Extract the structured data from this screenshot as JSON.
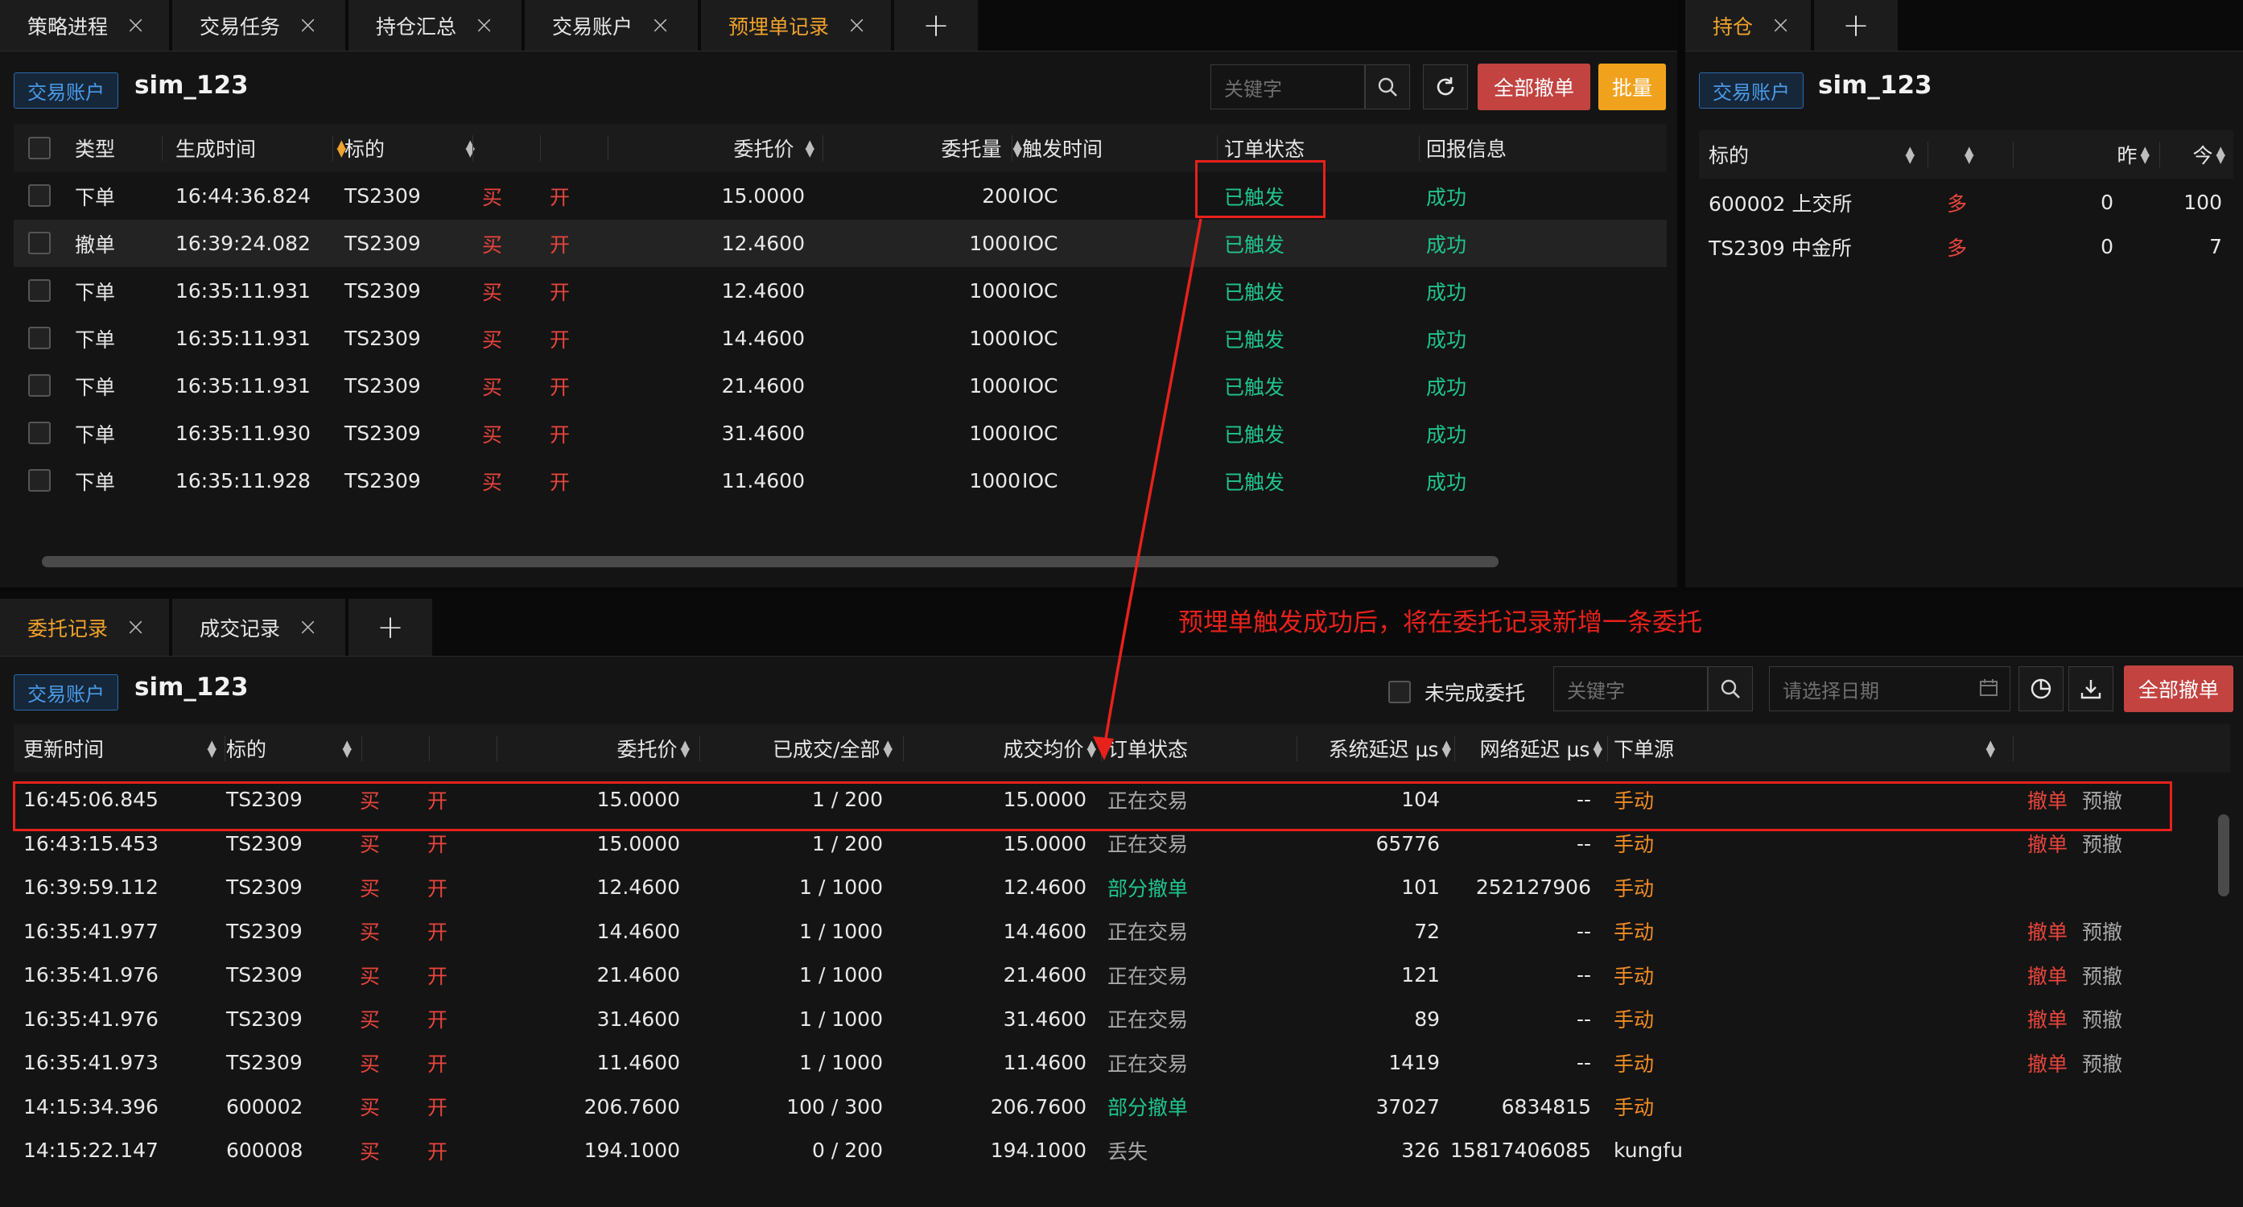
{
  "top_tabs": [
    {
      "label": "策略进程",
      "active": false
    },
    {
      "label": "交易任务",
      "active": false
    },
    {
      "label": "持仓汇总",
      "active": false
    },
    {
      "label": "交易账户",
      "active": false
    },
    {
      "label": "预埋单记录",
      "active": true
    }
  ],
  "right_tabs": [
    {
      "label": "持仓",
      "active": true
    }
  ],
  "bottom_tabs": [
    {
      "label": "委托记录",
      "active": true
    },
    {
      "label": "成交记录",
      "active": false
    }
  ],
  "common": {
    "close_glyph": "×",
    "plus_glyph": "+",
    "account_badge": "交易账户",
    "account_name": "sim_123"
  },
  "preorder": {
    "search_placeholder": "关键字",
    "cancel_all_label": "全部撤单",
    "batch_label": "批量",
    "columns": {
      "type": "类型",
      "time": "生成时间",
      "symbol": "标的",
      "price": "委托价",
      "volume": "委托量",
      "trigger": "触发时间",
      "status": "订单状态",
      "reply": "回报信息"
    },
    "rows": [
      {
        "type": "下单",
        "time": "16:44:36.824",
        "symbol": "TS2309",
        "side": "买",
        "offset": "开",
        "price": "15.0000",
        "volume": "200",
        "trigger": "IOC",
        "status": "已触发",
        "reply": "成功"
      },
      {
        "type": "撤单",
        "time": "16:39:24.082",
        "symbol": "TS2309",
        "side": "买",
        "offset": "开",
        "price": "12.4600",
        "volume": "1000",
        "trigger": "IOC",
        "status": "已触发",
        "reply": "成功"
      },
      {
        "type": "下单",
        "time": "16:35:11.931",
        "symbol": "TS2309",
        "side": "买",
        "offset": "开",
        "price": "12.4600",
        "volume": "1000",
        "trigger": "IOC",
        "status": "已触发",
        "reply": "成功"
      },
      {
        "type": "下单",
        "time": "16:35:11.931",
        "symbol": "TS2309",
        "side": "买",
        "offset": "开",
        "price": "14.4600",
        "volume": "1000",
        "trigger": "IOC",
        "status": "已触发",
        "reply": "成功"
      },
      {
        "type": "下单",
        "time": "16:35:11.931",
        "symbol": "TS2309",
        "side": "买",
        "offset": "开",
        "price": "21.4600",
        "volume": "1000",
        "trigger": "IOC",
        "status": "已触发",
        "reply": "成功"
      },
      {
        "type": "下单",
        "time": "16:35:11.930",
        "symbol": "TS2309",
        "side": "买",
        "offset": "开",
        "price": "31.4600",
        "volume": "1000",
        "trigger": "IOC",
        "status": "已触发",
        "reply": "成功"
      },
      {
        "type": "下单",
        "time": "16:35:11.928",
        "symbol": "TS2309",
        "side": "买",
        "offset": "开",
        "price": "11.4600",
        "volume": "1000",
        "trigger": "IOC",
        "status": "已触发",
        "reply": "成功"
      }
    ]
  },
  "position": {
    "columns": {
      "symbol": "标的",
      "yesterday": "昨",
      "today": "今"
    },
    "rows": [
      {
        "symbol": "600002 上交所",
        "dir": "多",
        "yesterday": "0",
        "today": "100"
      },
      {
        "symbol": "TS2309 中金所",
        "dir": "多",
        "yesterday": "0",
        "today": "7"
      }
    ]
  },
  "orders": {
    "unfinished_label": "未完成委托",
    "search_placeholder": "关键字",
    "date_placeholder": "请选择日期",
    "cancel_all_label": "全部撤单",
    "columns": {
      "time": "更新时间",
      "symbol": "标的",
      "price": "委托价",
      "filled": "已成交/全部",
      "avg": "成交均价",
      "status": "订单状态",
      "sys_latency": "系统延迟 μs",
      "net_latency": "网络延迟 μs",
      "source": "下单源"
    },
    "rows": [
      {
        "time": "16:45:06.845",
        "symbol": "TS2309",
        "side": "买",
        "offset": "开",
        "price": "15.0000",
        "filled": "1 / 200",
        "avg": "15.0000",
        "status": "正在交易",
        "status_kind": "gray",
        "sys": "104",
        "net": "--",
        "source": "手动",
        "source_kind": "orange",
        "cancel": "撤单",
        "precancel": "预撤"
      },
      {
        "time": "16:43:15.453",
        "symbol": "TS2309",
        "side": "买",
        "offset": "开",
        "price": "15.0000",
        "filled": "1 / 200",
        "avg": "15.0000",
        "status": "正在交易",
        "status_kind": "gray",
        "sys": "65776",
        "net": "--",
        "source": "手动",
        "source_kind": "orange",
        "cancel": "撤单",
        "precancel": "预撤"
      },
      {
        "time": "16:39:59.112",
        "symbol": "TS2309",
        "side": "买",
        "offset": "开",
        "price": "12.4600",
        "filled": "1 / 1000",
        "avg": "12.4600",
        "status": "部分撤单",
        "status_kind": "green",
        "sys": "101",
        "net": "252127906",
        "source": "手动",
        "source_kind": "orange",
        "cancel": "",
        "precancel": ""
      },
      {
        "time": "16:35:41.977",
        "symbol": "TS2309",
        "side": "买",
        "offset": "开",
        "price": "14.4600",
        "filled": "1 / 1000",
        "avg": "14.4600",
        "status": "正在交易",
        "status_kind": "gray",
        "sys": "72",
        "net": "--",
        "source": "手动",
        "source_kind": "orange",
        "cancel": "撤单",
        "precancel": "预撤"
      },
      {
        "time": "16:35:41.976",
        "symbol": "TS2309",
        "side": "买",
        "offset": "开",
        "price": "21.4600",
        "filled": "1 / 1000",
        "avg": "21.4600",
        "status": "正在交易",
        "status_kind": "gray",
        "sys": "121",
        "net": "--",
        "source": "手动",
        "source_kind": "orange",
        "cancel": "撤单",
        "precancel": "预撤"
      },
      {
        "time": "16:35:41.976",
        "symbol": "TS2309",
        "side": "买",
        "offset": "开",
        "price": "31.4600",
        "filled": "1 / 1000",
        "avg": "31.4600",
        "status": "正在交易",
        "status_kind": "gray",
        "sys": "89",
        "net": "--",
        "source": "手动",
        "source_kind": "orange",
        "cancel": "撤单",
        "precancel": "预撤"
      },
      {
        "time": "16:35:41.973",
        "symbol": "TS2309",
        "side": "买",
        "offset": "开",
        "price": "11.4600",
        "filled": "1 / 1000",
        "avg": "11.4600",
        "status": "正在交易",
        "status_kind": "gray",
        "sys": "1419",
        "net": "--",
        "source": "手动",
        "source_kind": "orange",
        "cancel": "撤单",
        "precancel": "预撤"
      },
      {
        "time": "14:15:34.396",
        "symbol": "600002",
        "side": "买",
        "offset": "开",
        "price": "206.7600",
        "filled": "100 / 300",
        "avg": "206.7600",
        "status": "部分撤单",
        "status_kind": "green",
        "sys": "37027",
        "net": "6834815",
        "source": "手动",
        "source_kind": "orange",
        "cancel": "",
        "precancel": ""
      },
      {
        "time": "14:15:22.147",
        "symbol": "600008",
        "side": "买",
        "offset": "开",
        "price": "194.1000",
        "filled": "0 / 200",
        "avg": "194.1000",
        "status": "丢失",
        "status_kind": "gray",
        "sys": "326",
        "net": "15817406085",
        "source": "kungfu",
        "source_kind": "white",
        "cancel": "",
        "precancel": ""
      }
    ]
  },
  "annotation": {
    "text": "预埋单触发成功后，将在委托记录新增一条委托"
  }
}
